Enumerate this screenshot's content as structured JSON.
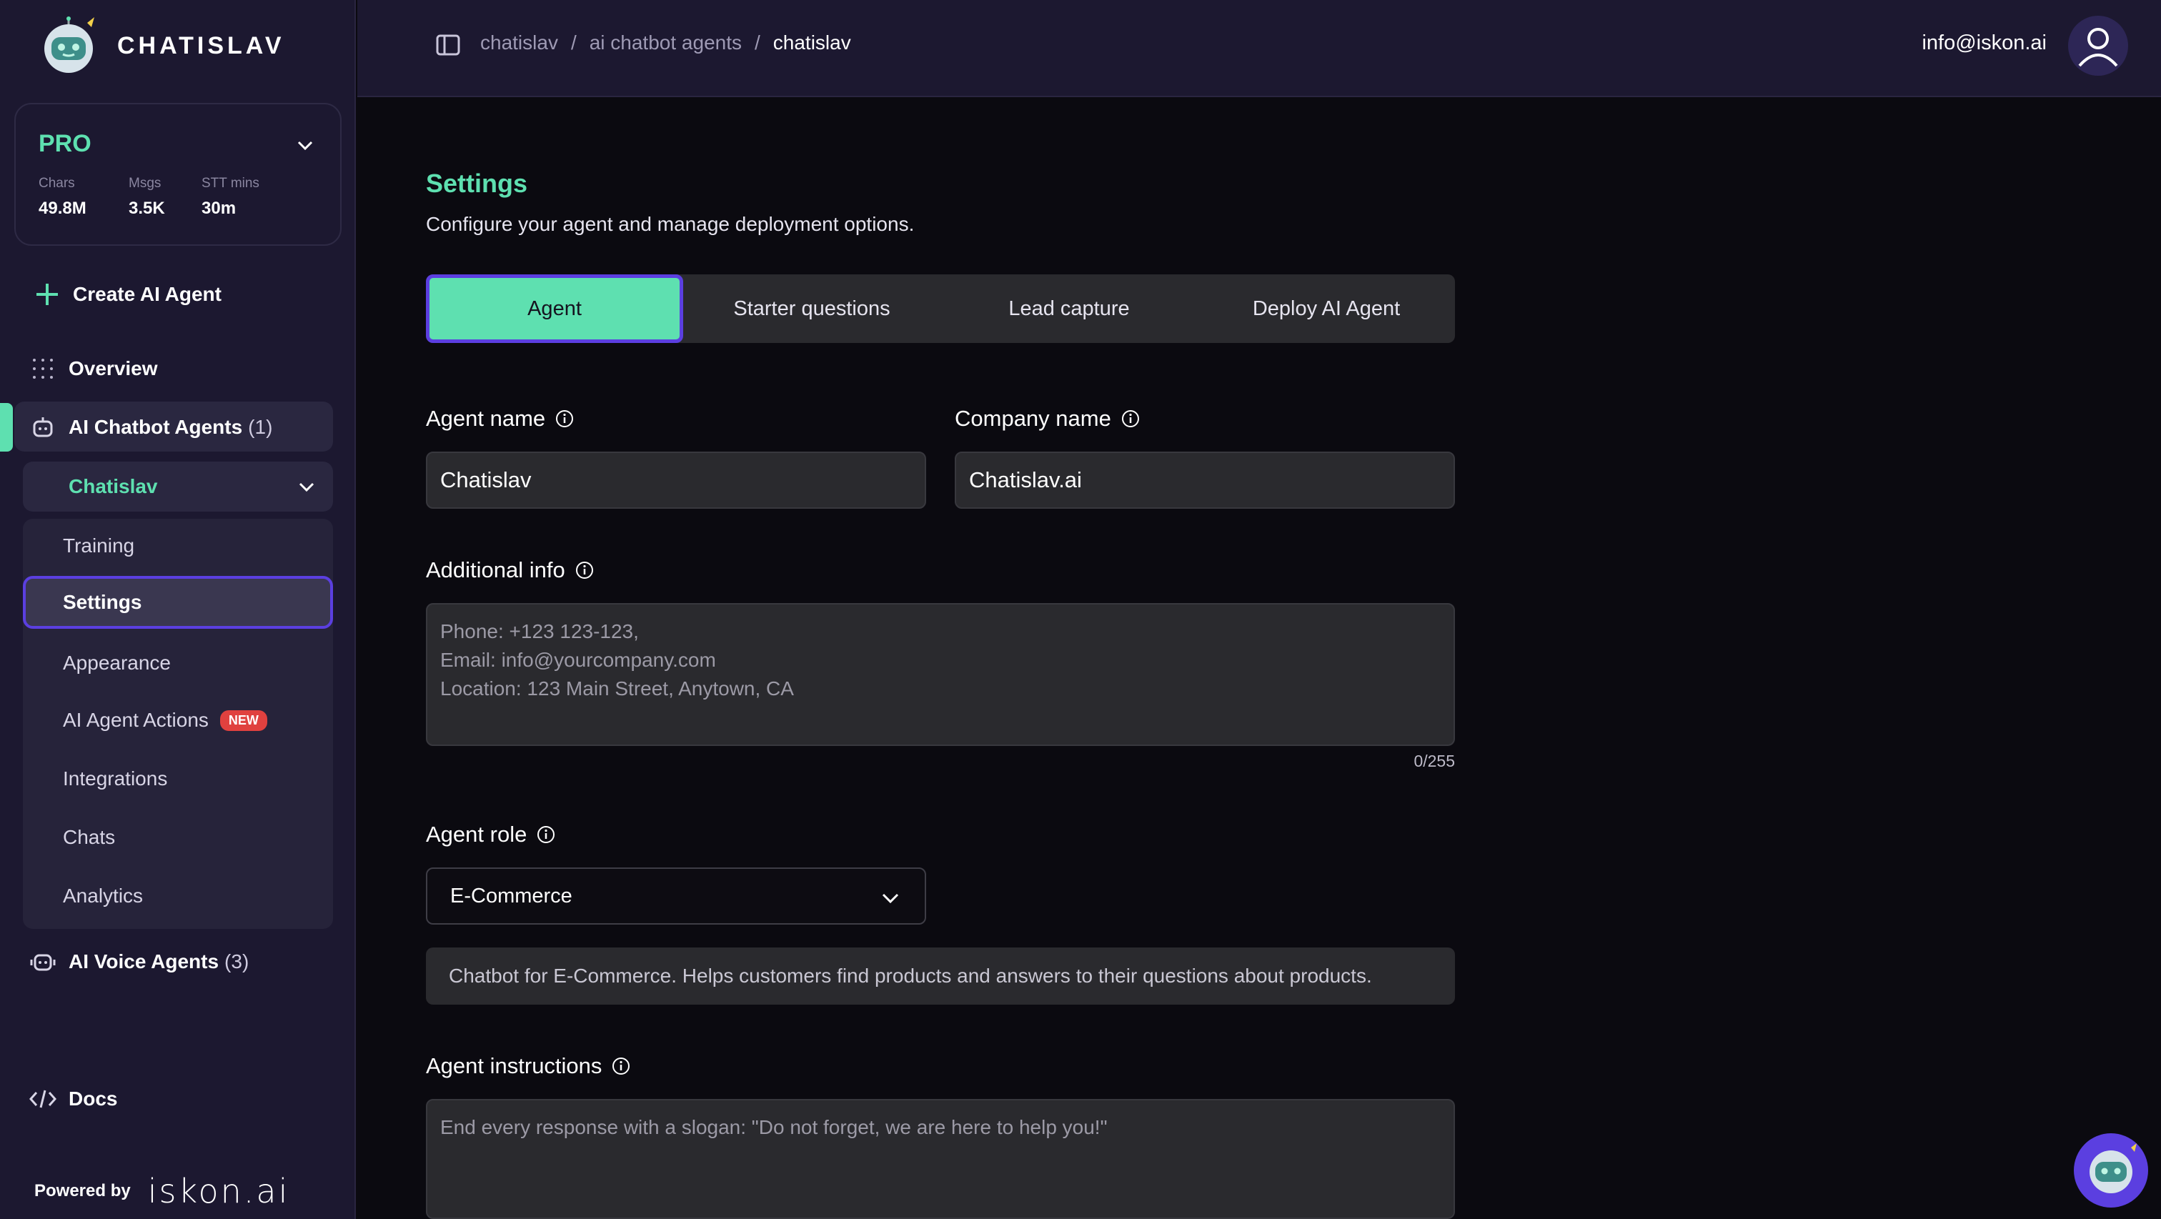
{
  "app": {
    "logo_text": "CHATISLAV"
  },
  "plan": {
    "name": "PRO",
    "stats": [
      {
        "label": "Chars",
        "value": "49.8M"
      },
      {
        "label": "Msgs",
        "value": "3.5K"
      },
      {
        "label": "STT mins",
        "value": "30m"
      }
    ]
  },
  "sidebar": {
    "create_label": "Create AI Agent",
    "overview_label": "Overview",
    "chatbot_agents_label": "AI Chatbot Agents",
    "chatbot_agents_count": "(1)",
    "agent_name": "Chatislav",
    "sub_items": [
      "Training",
      "Settings",
      "Appearance",
      "AI Agent Actions",
      "Integrations",
      "Chats",
      "Analytics"
    ],
    "new_badge": "NEW",
    "voice_agents_label": "AI Voice Agents",
    "voice_agents_count": "(3)",
    "docs_label": "Docs",
    "powered_by": "Powered by",
    "powered_brand": "iskon.ai"
  },
  "topbar": {
    "breadcrumb": [
      "chatislav",
      "ai chatbot agents",
      "chatislav"
    ],
    "separator": "/",
    "user_email": "info@iskon.ai"
  },
  "settings": {
    "title": "Settings",
    "subtitle": "Configure your agent and manage deployment options.",
    "tabs": [
      "Agent",
      "Starter questions",
      "Lead capture",
      "Deploy AI Agent"
    ],
    "active_tab": "Agent",
    "agent_name_label": "Agent name",
    "agent_name_value": "Chatislav",
    "company_name_label": "Company name",
    "company_name_value": "Chatislav.ai",
    "additional_info_label": "Additional info",
    "additional_info_placeholder": "Phone: +123 123-123,\nEmail: info@yourcompany.com\nLocation: 123 Main Street, Anytown, CA",
    "additional_info_counter": "0/255",
    "agent_role_label": "Agent role",
    "agent_role_value": "E-Commerce",
    "agent_role_description": "Chatbot for E-Commerce. Helps customers find products and answers to their questions about products.",
    "agent_instructions_label": "Agent instructions",
    "agent_instructions_placeholder": "End every response with a slogan: \"Do not forget, we are here to help you!\""
  },
  "colors": {
    "accent_green": "#5ee0b0",
    "accent_purple": "#5b3fe0",
    "sidebar_bg": "#1c1830",
    "badge_red": "#e0413f"
  }
}
